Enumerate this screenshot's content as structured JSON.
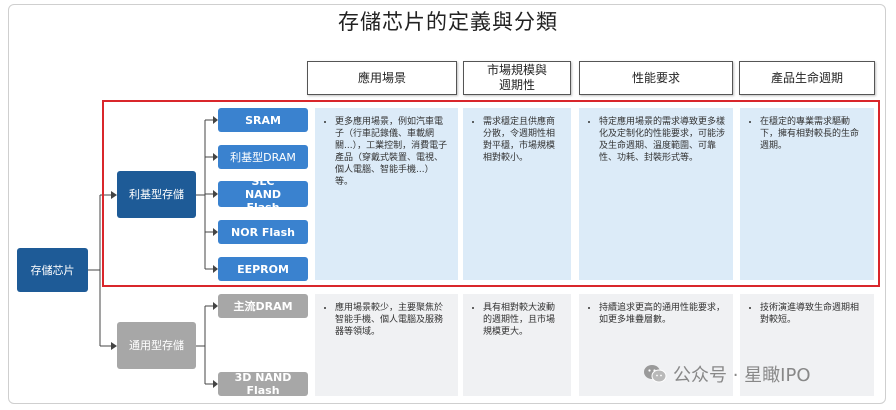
{
  "title": "存儲芯片的定義與分類",
  "headers": [
    "應用場景",
    "市場規模與\n週期性",
    "性能要求",
    "產品生命週期"
  ],
  "root": "存儲芯片",
  "groups": [
    {
      "name": "利基型存儲",
      "items": [
        "SRAM",
        "利基型DRAM",
        "SLC NAND Flash",
        "NOR Flash",
        "EEPROM"
      ],
      "cells": [
        "更多應用場景，例如汽車電子（行車記錄儀、車載網關...），工業控制，消費電子產品（穿戴式裝置、電視、個人電腦、智能手機...）等。",
        "需求穩定且供應商分散，令週期性相對平穩，市場規模相對較小。",
        "特定應用場景的需求導致更多樣化及定制化的性能要求，可能涉及生命週期、溫度範圍、可靠性、功耗、封裝形式等。",
        "在穩定的專業需求驅動下，擁有相對較長的生命週期。"
      ]
    },
    {
      "name": "通用型存儲",
      "items": [
        "主流DRAM",
        "3D NAND Flash"
      ],
      "cells": [
        "應用場景較少，主要聚焦於智能手機、個人電腦及服務器等領域。",
        "具有相對較大波動的週期性，且市場規模更大。",
        "持續追求更高的通用性能要求，如更多堆疊層數。",
        "技術演進導致生命週期相對較短。"
      ]
    }
  ],
  "watermark": "公众号 · 星瞰IPO",
  "colors": {
    "highlight": "#d9262b",
    "dark_blue": "#1e5b97",
    "blue": "#3a82cf",
    "gray": "#a7a7a7"
  }
}
